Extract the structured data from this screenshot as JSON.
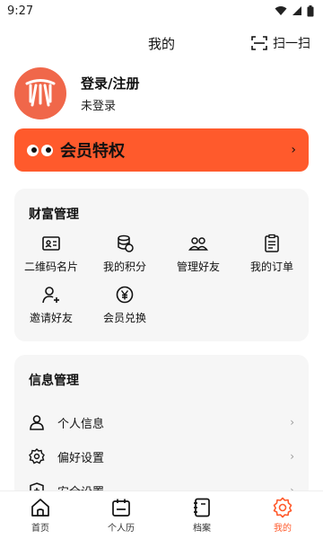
{
  "status": {
    "time": "9:27"
  },
  "header": {
    "title": "我的",
    "scan_label": "扫一扫"
  },
  "profile": {
    "login_label": "登录/注册",
    "status_label": "未登录"
  },
  "vip": {
    "label": "会员特权",
    "chevron": "›"
  },
  "wealth": {
    "title": "财富管理",
    "items": [
      {
        "label": "二维码名片",
        "icon": "id-card-icon"
      },
      {
        "label": "我的积分",
        "icon": "coins-icon"
      },
      {
        "label": "管理好友",
        "icon": "friends-icon"
      },
      {
        "label": "我的订单",
        "icon": "order-icon"
      },
      {
        "label": "邀请好友",
        "icon": "invite-icon"
      },
      {
        "label": "会员兑换",
        "icon": "yen-icon"
      }
    ]
  },
  "info": {
    "title": "信息管理",
    "items": [
      {
        "label": "个人信息",
        "icon": "person-icon",
        "chevron": "›"
      },
      {
        "label": "偏好设置",
        "icon": "gear-icon",
        "chevron": "›"
      },
      {
        "label": "安全设置",
        "icon": "shield-icon",
        "chevron": "›"
      }
    ]
  },
  "tabbar": {
    "items": [
      {
        "label": "首页",
        "icon": "home-icon"
      },
      {
        "label": "个人历",
        "icon": "calendar-icon"
      },
      {
        "label": "档案",
        "icon": "archive-icon"
      },
      {
        "label": "我的",
        "icon": "settings-icon",
        "active": true
      }
    ]
  },
  "colors": {
    "accent": "#ff5a2c",
    "avatar": "#f0674a",
    "card_bg": "#f6f6f6"
  }
}
